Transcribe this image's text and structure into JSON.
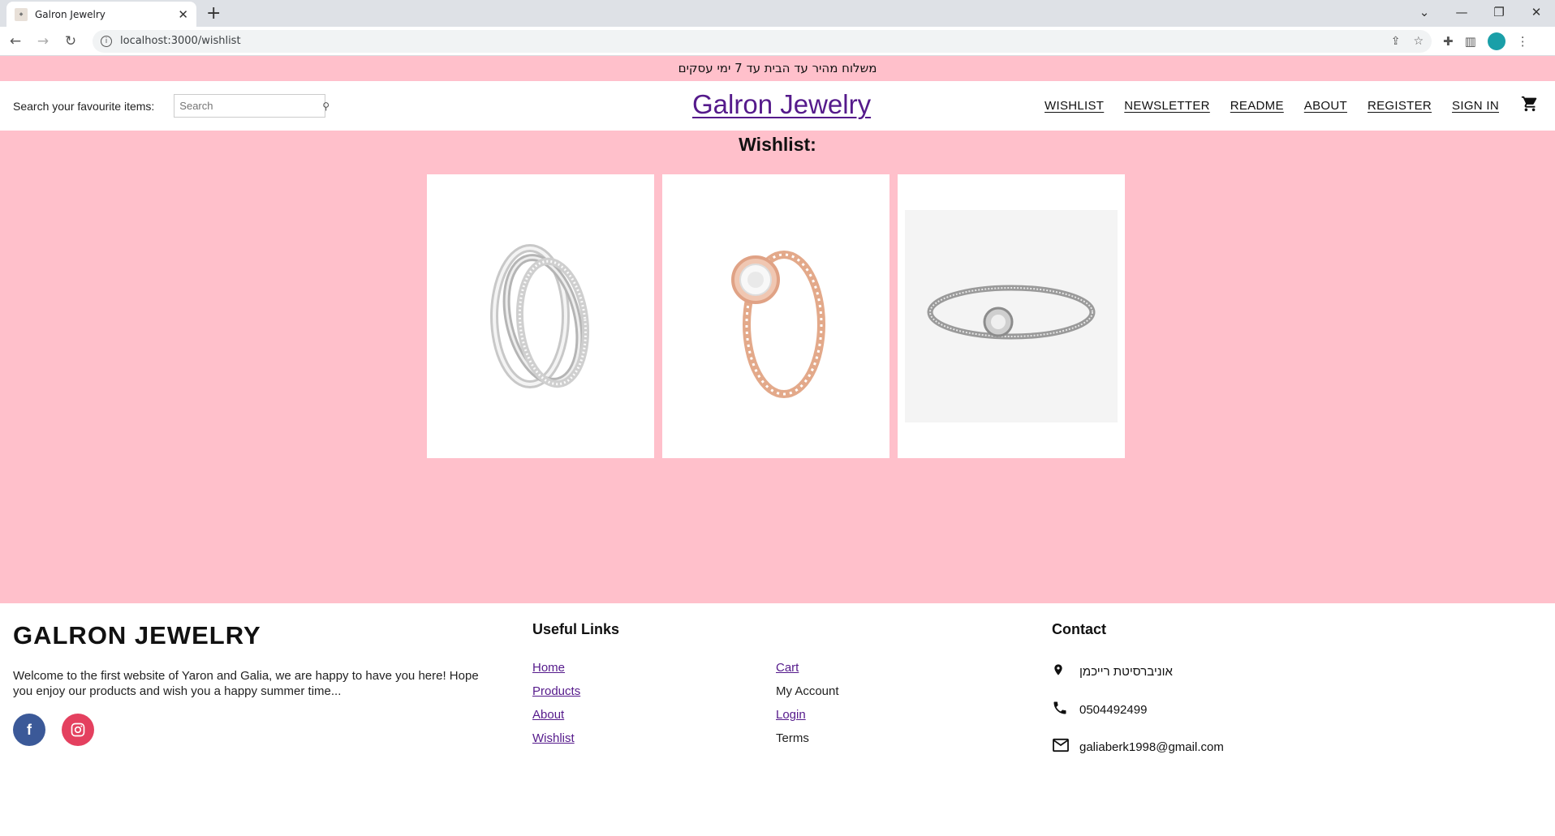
{
  "browser": {
    "tab_title": "Galron Jewelry",
    "url": "localhost:3000/wishlist",
    "new_tab": "+",
    "close_tab": "✕",
    "window_controls": [
      "⌄",
      "—",
      "❐",
      "✕"
    ]
  },
  "promo": {
    "text": "משלוח מהיר עד הבית עד 7 ימי עסקים"
  },
  "header": {
    "search_label": "Search your favourite items:",
    "search_placeholder": "Search",
    "logo": "Galron Jewelry",
    "nav": [
      "WISHLIST",
      "NEWSLETTER",
      "README",
      "ABOUT",
      "REGISTER",
      "SIGN IN"
    ],
    "cart_icon": "cart-icon"
  },
  "main": {
    "title": "Wishlist:",
    "items": [
      {
        "image": "silver-triple-ring"
      },
      {
        "image": "rose-gold-halo-ring"
      },
      {
        "image": "silver-bracelet"
      }
    ]
  },
  "footer": {
    "brand": "GALRON JEWELRY",
    "description": "Welcome to the first website of Yaron and Galia, we are happy to have you here! Hope you enjoy our products and wish you a happy summer time...",
    "useful_links_title": "Useful Links",
    "links_col1": [
      "Home",
      "Products",
      "About",
      "Wishlist"
    ],
    "links_col2": [
      "Cart",
      "My Account",
      "Login",
      "Terms"
    ],
    "contact_title": "Contact",
    "contact": {
      "address": "אוניברסיטת רייכמן",
      "phone": "0504492499",
      "email": "galiaberk1998@gmail.com"
    },
    "social": [
      "facebook-icon",
      "instagram-icon"
    ]
  },
  "colors": {
    "pink": "#ffc0cb",
    "link": "#551a8b"
  }
}
